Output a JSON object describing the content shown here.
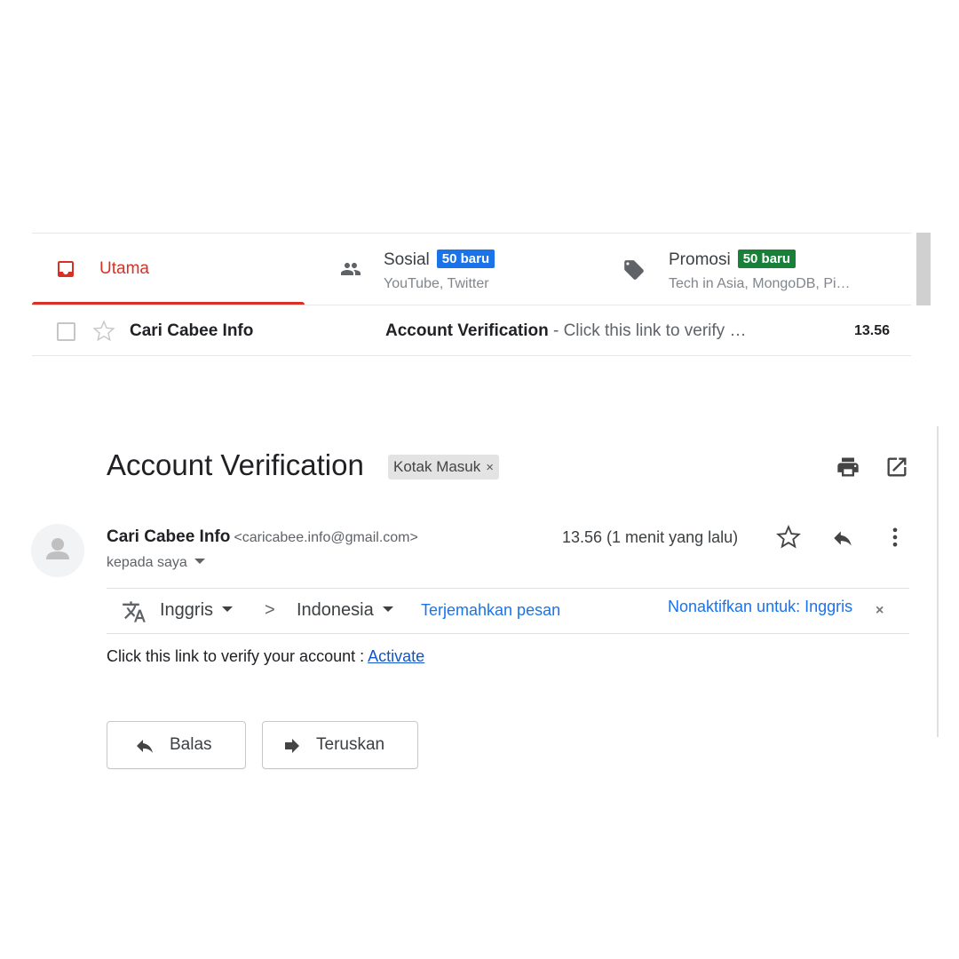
{
  "inbox": {
    "tabs": [
      {
        "label": "Utama",
        "icon": "inbox-icon",
        "active": true
      },
      {
        "label": "Sosial",
        "icon": "people-icon",
        "badge": "50 baru",
        "sub": "YouTube, Twitter",
        "badge_color": "#1a73e8"
      },
      {
        "label": "Promosi",
        "icon": "tag-icon",
        "badge": "50 baru",
        "sub": "Tech in Asia, MongoDB, Pi…",
        "badge_color": "#188038"
      }
    ],
    "row": {
      "sender": "Cari Cabee Info",
      "subject": "Account Verification",
      "snippet": " - Click this link to verify …",
      "time": "13.56"
    }
  },
  "message": {
    "subject": "Account Verification",
    "label": "Kotak Masuk",
    "label_close": "×",
    "sender_name": "Cari Cabee Info",
    "sender_email": "<caricabee.info@gmail.com>",
    "to": "kepada saya",
    "time": "13.56 (1 menit yang lalu)",
    "translate": {
      "from": "Inggris",
      "arrow": ">",
      "to": "Indonesia",
      "translate_link": "Terjemahkan pesan",
      "disable": "Nonaktifkan untuk: Inggris",
      "close": "×"
    },
    "body_text": "Click this link to verify your account : ",
    "body_link": "Activate",
    "reply_button": "Balas",
    "forward_button": "Teruskan"
  },
  "colors": {
    "accent_red": "#d93025",
    "link_blue": "#1a73e8"
  }
}
